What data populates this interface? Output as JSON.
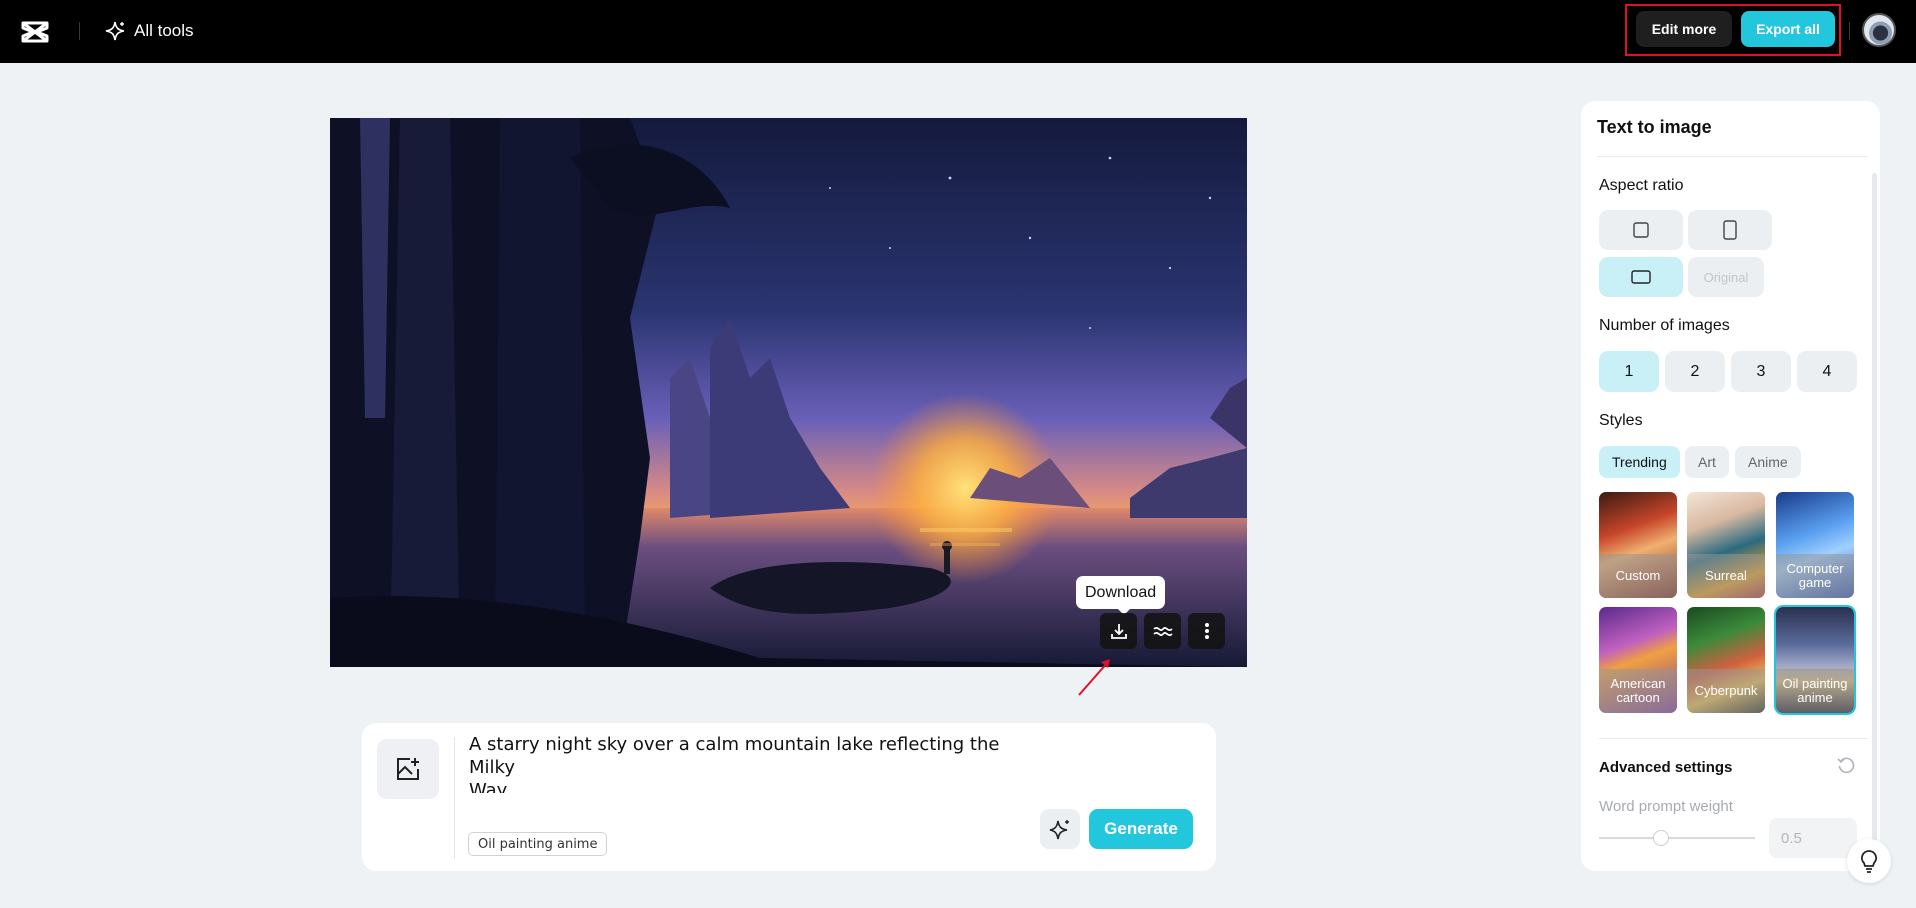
{
  "topbar": {
    "all_tools_label": "All tools",
    "edit_more_label": "Edit more",
    "export_all_label": "Export all",
    "logo_icon": "capcut-logo-icon",
    "sparkle_icon": "sparkle-icon"
  },
  "canvas": {
    "tooltip": "Download",
    "actions": [
      {
        "name": "download-button",
        "icon": "download-icon"
      },
      {
        "name": "enhance-button",
        "icon": "wave-icon"
      },
      {
        "name": "more-options-button",
        "icon": "more-vertical-icon"
      }
    ]
  },
  "prompt": {
    "text": "A starry night sky over a calm mountain lake reflecting the Milky\nWay",
    "style_chip": "Oil painting anime",
    "generate_label": "Generate"
  },
  "panel": {
    "title": "Text to image",
    "aspect_ratio_label": "Aspect ratio",
    "aspect_original_label": "Original",
    "number_label": "Number of images",
    "numbers": [
      "1",
      "2",
      "3",
      "4"
    ],
    "selected_number": "1",
    "styles_label": "Styles",
    "style_tabs": [
      "Trending",
      "Art",
      "Anime"
    ],
    "style_tiles": [
      "Custom",
      "Surreal",
      "Computer game",
      "American cartoon",
      "Cyberpunk",
      "Oil painting anime"
    ],
    "selected_style": "Oil painting anime",
    "advanced_label": "Advanced settings",
    "weight_label": "Word prompt weight",
    "weight_value": "0.5",
    "weight_slider_fraction": 0.4
  },
  "colors": {
    "accent": "#22c7de",
    "accent_soft": "#c9f0f6",
    "highlight_box": "#e0102a"
  }
}
